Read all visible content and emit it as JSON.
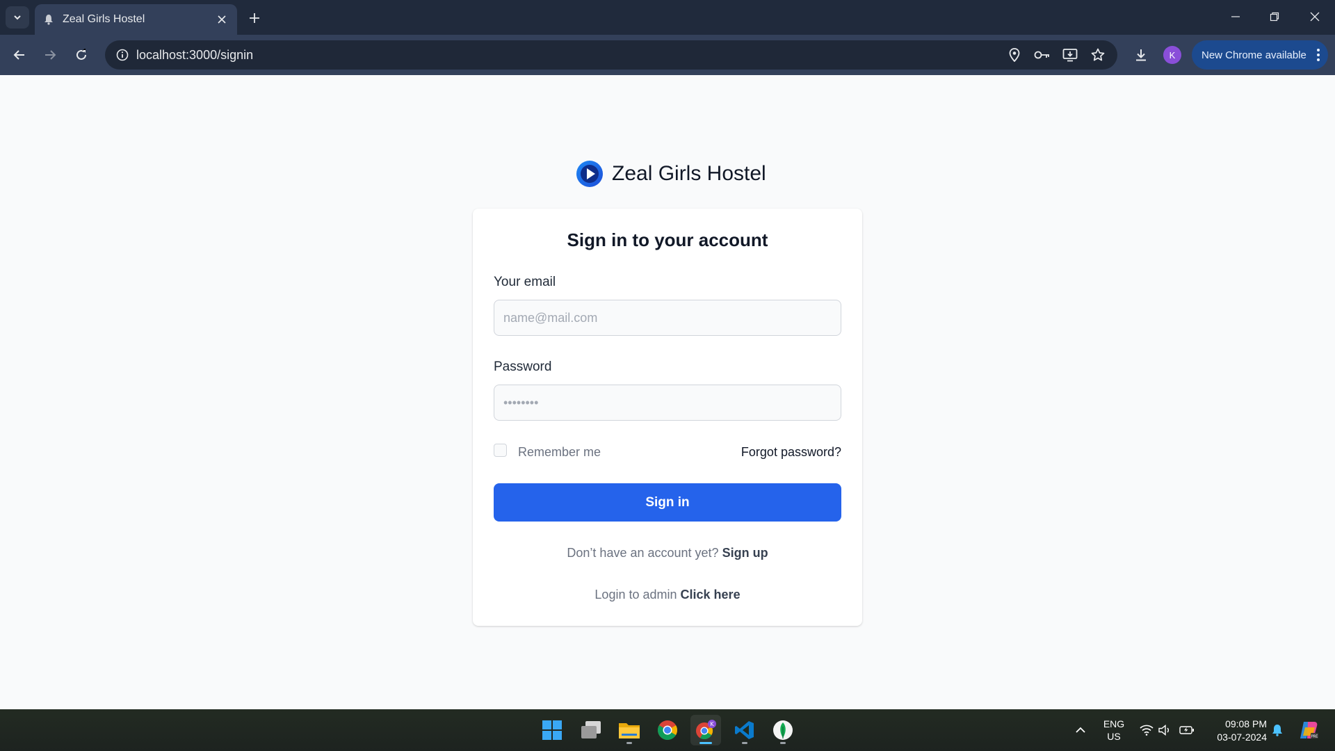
{
  "browser": {
    "tab_title": "Zeal Girls Hostel",
    "url": "localhost:3000/signin",
    "profile_initial": "K",
    "update_label": "New Chrome available"
  },
  "page": {
    "brand_name": "Zeal Girls Hostel",
    "card_title": "Sign in to your account",
    "email_label": "Your email",
    "email_placeholder": "name@mail.com",
    "email_value": "",
    "password_label": "Password",
    "password_placeholder": "••••••••",
    "remember_label": "Remember me",
    "remember_checked": false,
    "forgot_label": "Forgot password?",
    "signin_label": "Sign in",
    "signup_prompt": "Don’t have an account yet?",
    "signup_link": "Sign up",
    "admin_prompt": "Login to admin",
    "admin_link": "Click here"
  },
  "taskbar": {
    "apps": [
      "start-icon",
      "task-view-icon",
      "file-explorer-icon",
      "chrome-icon",
      "chrome-profile-icon",
      "vscode-icon",
      "mongodb-compass-icon"
    ],
    "language_top": "ENG",
    "language_bottom": "US",
    "time": "09:08 PM",
    "date": "03-07-2024"
  },
  "colors": {
    "primary": "#2563eb",
    "browser_frame": "#202a3c",
    "toolbar": "#33405a",
    "page_bg": "#f9fafb"
  }
}
